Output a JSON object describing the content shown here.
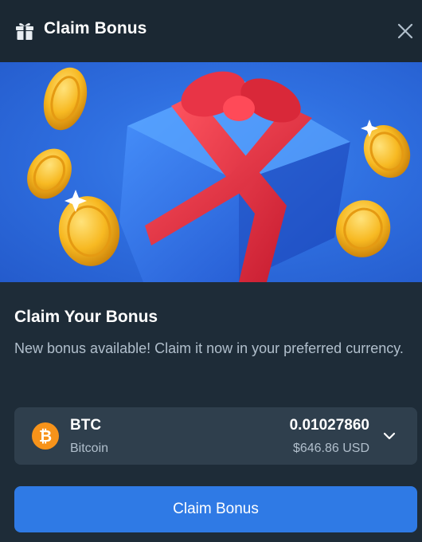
{
  "header": {
    "title": "Claim Bonus",
    "gift_icon": "gift-icon",
    "close_icon": "close-icon"
  },
  "banner": {
    "image": "gift-box-with-coins-illustration"
  },
  "content": {
    "title": "Claim Your Bonus",
    "description": "New bonus available! Claim it now in your preferred currency."
  },
  "currency": {
    "symbol": "BTC",
    "name": "Bitcoin",
    "amount": "0.01027860",
    "usd_value": "$646.86 USD",
    "coin_icon": "bitcoin-icon",
    "chevron_icon": "chevron-down-icon"
  },
  "button": {
    "label": "Claim Bonus"
  },
  "colors": {
    "background": "#1e2c38",
    "header": "#1b2833",
    "select_background": "#2f3f4d",
    "accent_button": "#2f7ae5",
    "muted_text": "#b1bfcc",
    "bitcoin_orange": "#f7931a"
  }
}
